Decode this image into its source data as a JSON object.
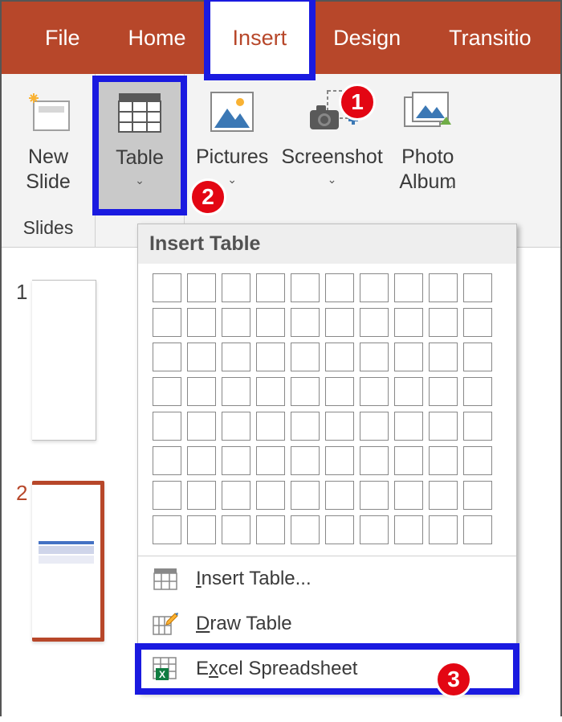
{
  "tabs": {
    "file": "File",
    "home": "Home",
    "insert": "Insert",
    "design": "Design",
    "transitions": "Transitio"
  },
  "commands": {
    "new_slide": "New\nSlide",
    "table": "Table",
    "pictures": "Pictures",
    "screenshot": "Screenshot",
    "photo_album": "Photo\nAlbum"
  },
  "groups": {
    "slides": "Slides"
  },
  "dropdown": {
    "header": "Insert Table",
    "insert_table": "Insert Table...",
    "draw_table": "Draw Table",
    "excel": "Excel Spreadsheet",
    "grid_cols": 10,
    "grid_rows": 8
  },
  "thumbs": {
    "n1": "1",
    "n2": "2"
  },
  "callouts": {
    "c1": "1",
    "c2": "2",
    "c3": "3"
  }
}
